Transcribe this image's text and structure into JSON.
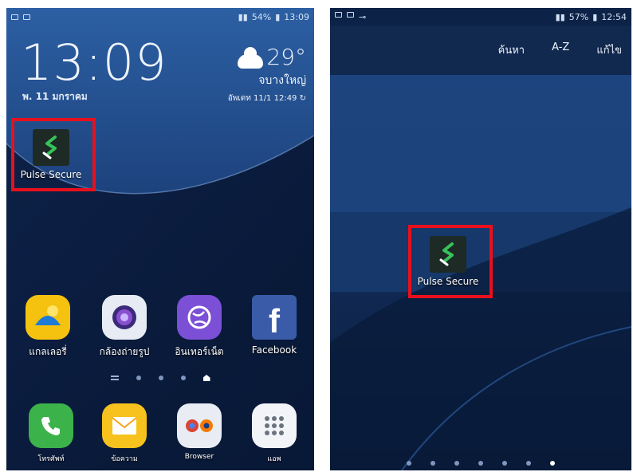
{
  "left": {
    "status": {
      "battery": "54%",
      "time": "13:09"
    },
    "clock": "13:09",
    "date": "พ. 11 มกราคม",
    "weather": {
      "temp": "29°",
      "location": "จบางใหญ่",
      "updated": "อัพเดท 11/1 12:49"
    },
    "highlight_app": {
      "label": "Pulse Secure"
    },
    "apps": [
      {
        "label": "แกลเลอรี่",
        "icon": "gallery-icon"
      },
      {
        "label": "กล้องถ่ายรูป",
        "icon": "camera-icon"
      },
      {
        "label": "อินเทอร์เน็ต",
        "icon": "internet-icon"
      },
      {
        "label": "Facebook",
        "icon": "facebook-icon"
      }
    ],
    "dock": [
      {
        "label": "โทรศัพท์",
        "icon": "phone-icon"
      },
      {
        "label": "ข้อความ",
        "icon": "message-icon"
      },
      {
        "label": "Browser",
        "icon": "browser-icon"
      },
      {
        "label": "แอพ",
        "icon": "apps-grid-icon"
      }
    ]
  },
  "right": {
    "status": {
      "battery": "57%",
      "time": "12:54"
    },
    "menu": [
      "ค้นหา",
      "A-Z",
      "แก้ไข"
    ],
    "highlight_app": {
      "label": "Pulse Secure"
    }
  },
  "colors": {
    "highlight": "#e8101d",
    "wallpaper": "#0e2a55"
  }
}
